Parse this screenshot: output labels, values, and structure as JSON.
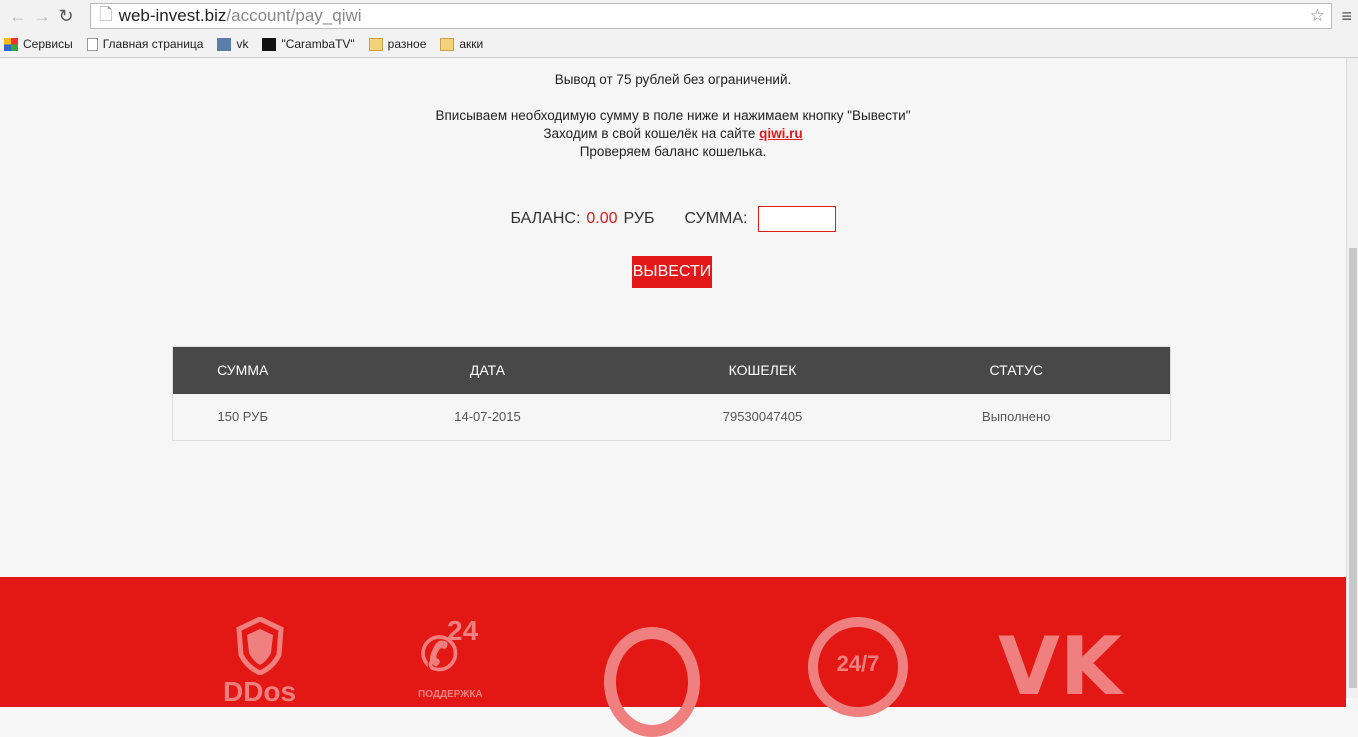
{
  "browser": {
    "url_host": "web-invest.biz",
    "url_path": "/account/pay_qiwi",
    "bookmarks": [
      "Сервисы",
      "Главная страница",
      "vk",
      "\"CarambaTV\"",
      "разное",
      "акки"
    ]
  },
  "info": {
    "line1": "Вывод от 75 рублей без ограничений.",
    "line2": "Вписываем необходимую сумму в поле ниже и нажимаем кнопку \"Вывести\"",
    "line3_pre": "Заходим в свой кошелёк на сайте ",
    "line3_link": "qiwi.ru",
    "line4": "Проверяем баланс кошелька."
  },
  "balance": {
    "label": "БАЛАНС:",
    "value": "0.00",
    "currency": "РУБ",
    "sum_label": "СУММА:",
    "sum_value": ""
  },
  "withdraw_button": "ВЫВЕСТИ",
  "table": {
    "headers": [
      "СУММА",
      "ДАТА",
      "КОШЕЛЕК",
      "СТАТУС"
    ],
    "rows": [
      [
        "150 РУБ",
        "14-07-2015",
        "79530047405",
        "Выполнено"
      ]
    ]
  },
  "footer": {
    "ddos": "DDos",
    "support_24": "24",
    "support": "ПОДДЕРЖКА",
    "clock": "24/7"
  },
  "colors": {
    "accent": "#e31818"
  }
}
